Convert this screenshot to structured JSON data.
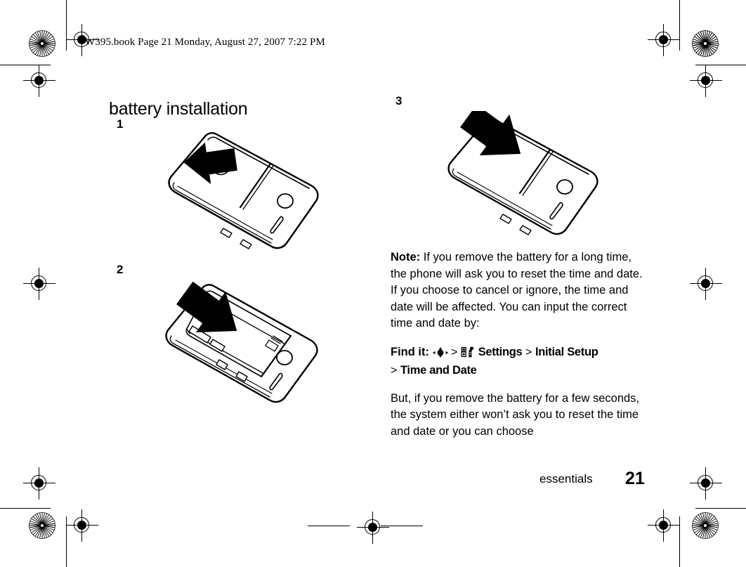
{
  "document": {
    "header_note": "W395.book  Page 21  Monday, August 27, 2007  7:22 PM",
    "title": "battery installation",
    "footer_section": "essentials",
    "page_number": "21"
  },
  "steps": [
    {
      "number": "1",
      "caption": "Phone shown from the back with an arrow pointing up-left to slide the battery cover off"
    },
    {
      "number": "2",
      "caption": "Battery cover removed, arrow pointing down-right to seat the battery in the compartment"
    },
    {
      "number": "3",
      "caption": "Battery cover replaced, arrow pointing down-right to slide the cover back on"
    }
  ],
  "note": {
    "label": "Note:",
    "text": " If you remove the battery for a long time, the phone will ask you to reset the time and date. If you choose to cancel or ignore, the time and date will be affected. You can input the correct time and date by:"
  },
  "find_it": {
    "label": "Find it:",
    "nav_icon": "joystick-nav-icon",
    "separator": ">",
    "settings_icon": "settings-wrench-icon",
    "item_settings": "Settings",
    "item_initial_setup": "Initial Setup",
    "item_time_and_date": "Time and Date"
  },
  "closing_paragraph": "But, if you remove the battery for a few seconds, the system either won’t ask you to reset the time and date or you can choose",
  "colors": {
    "ink": "#000000",
    "paper": "#ffffff"
  }
}
